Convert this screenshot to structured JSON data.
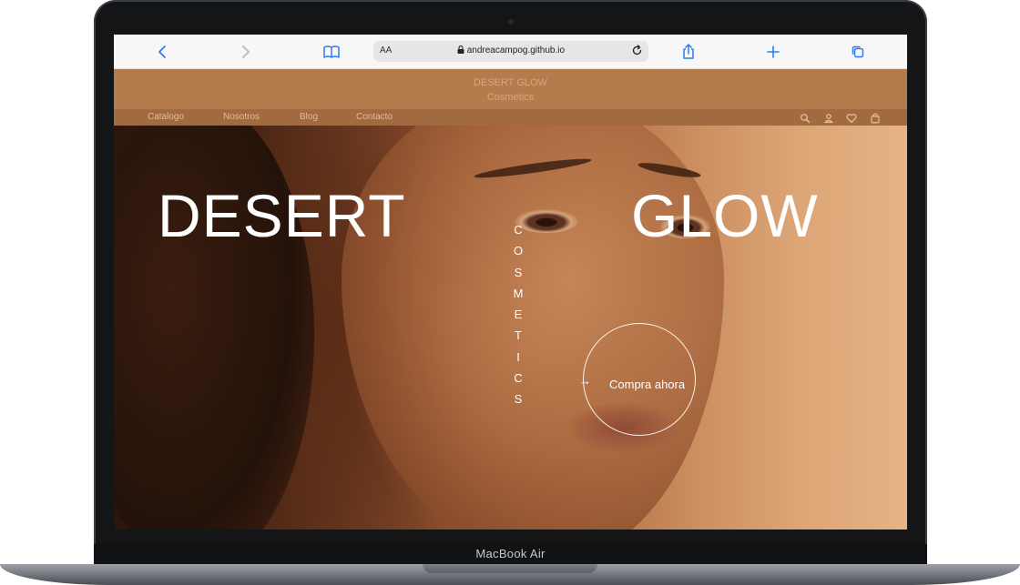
{
  "device": {
    "model_label": "MacBook Air"
  },
  "browser": {
    "url": "andreacampog.github.io",
    "text_size_label": "AA",
    "icons": [
      "back-icon",
      "forward-icon",
      "book-icon",
      "lock-icon",
      "reload-icon",
      "share-icon",
      "plus-icon",
      "tabs-icon"
    ]
  },
  "site": {
    "brand_name": "DESERT GLOW",
    "brand_sub": "Cosmetics",
    "nav": [
      "Catalogo",
      "Nosotros",
      "Blog",
      "Contacto"
    ],
    "nav_icons": [
      "search-icon",
      "user-icon",
      "heart-icon",
      "bag-icon"
    ],
    "hero": {
      "word_left": "DESERT",
      "word_right": "GLOW",
      "vertical_letters": [
        "C",
        "O",
        "S",
        "M",
        "E",
        "T",
        "I",
        "C",
        "S"
      ],
      "cta_arrow": "→",
      "cta_label": "Compra ahora"
    },
    "colors": {
      "brandbar": "#b47b4d",
      "navbar": "#a26a3f",
      "brand_text": "#d7a67d"
    }
  }
}
